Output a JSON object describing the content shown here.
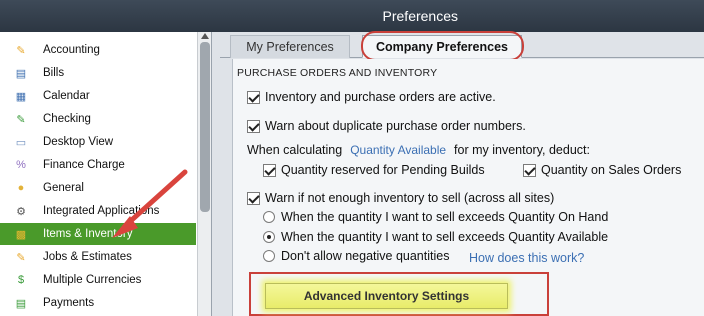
{
  "window": {
    "title": "Preferences"
  },
  "sidebar": {
    "items": [
      {
        "label": "Accounting",
        "icon": "accounting-icon",
        "glyph": "✎",
        "color": "#e8a82c",
        "selected": false
      },
      {
        "label": "Bills",
        "icon": "bills-icon",
        "glyph": "▤",
        "color": "#3f6fb0",
        "selected": false
      },
      {
        "label": "Calendar",
        "icon": "calendar-icon",
        "glyph": "▦",
        "color": "#3f6fb0",
        "selected": false
      },
      {
        "label": "Checking",
        "icon": "checking-icon",
        "glyph": "✎",
        "color": "#3a9b3a",
        "selected": false
      },
      {
        "label": "Desktop View",
        "icon": "desktop-view-icon",
        "glyph": "▭",
        "color": "#6f8fbf",
        "selected": false
      },
      {
        "label": "Finance Charge",
        "icon": "finance-charge-icon",
        "glyph": "%",
        "color": "#8f6fc0",
        "selected": false
      },
      {
        "label": "General",
        "icon": "general-icon",
        "glyph": "●",
        "color": "#e3b33a",
        "selected": false
      },
      {
        "label": "Integrated Applications",
        "icon": "integrated-applications-icon",
        "glyph": "⚙",
        "color": "#555555",
        "selected": false
      },
      {
        "label": "Items & Inventory",
        "icon": "items-inventory-icon",
        "glyph": "▩",
        "color": "#e8b830",
        "selected": true
      },
      {
        "label": "Jobs & Estimates",
        "icon": "jobs-estimates-icon",
        "glyph": "✎",
        "color": "#e8a82c",
        "selected": false
      },
      {
        "label": "Multiple Currencies",
        "icon": "multiple-currencies-icon",
        "glyph": "$",
        "color": "#3a9b3a",
        "selected": false
      },
      {
        "label": "Payments",
        "icon": "payments-icon",
        "glyph": "▤",
        "color": "#3a9b3a",
        "selected": false
      }
    ]
  },
  "tabs": {
    "my_preferences": "My Preferences",
    "company_preferences": "Company Preferences"
  },
  "section": {
    "title": "PURCHASE ORDERS AND INVENTORY",
    "inventory_active": {
      "label": "Inventory and purchase orders are active.",
      "checked": true
    },
    "warn_duplicate_po": {
      "label": "Warn about duplicate purchase order numbers.",
      "checked": true
    },
    "when_calculating_prefix": "When calculating",
    "quantity_available_combo": "Quantity Available",
    "when_calculating_suffix": "for my inventory, deduct:",
    "qty_reserved_pending": {
      "label": "Quantity reserved for Pending Builds",
      "checked": true
    },
    "qty_on_sales_orders": {
      "label": "Quantity on Sales Orders",
      "checked": true
    },
    "warn_not_enough": {
      "label": "Warn if not enough inventory to sell (across all sites)",
      "checked": true
    },
    "radio_on_hand": {
      "label": "When the quantity I want to sell exceeds Quantity On Hand",
      "checked": false
    },
    "radio_available": {
      "label": "When the quantity I want to sell exceeds Quantity Available",
      "checked": true
    },
    "radio_no_negative": {
      "label": "Don't allow negative quantities",
      "checked": false
    },
    "how_does_this_work": "How does this work?",
    "advanced_button": "Advanced Inventory Settings"
  },
  "colors": {
    "highlight_red": "#c9403a",
    "selected_green": "#4a9a2a",
    "button_yellow": "#eef26b",
    "link_blue": "#3b6fb3"
  }
}
